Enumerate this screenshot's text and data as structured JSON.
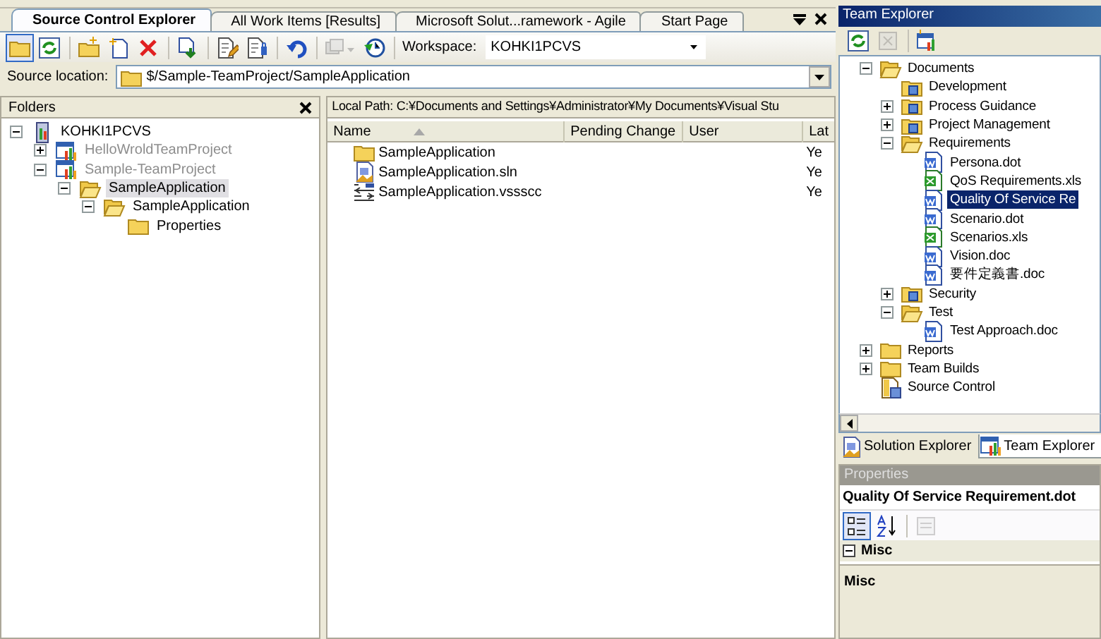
{
  "document_tabs": [
    {
      "label": "Source Control Explorer",
      "selected": true
    },
    {
      "label": "All Work Items [Results]",
      "selected": false
    },
    {
      "label": "Microsoft Solut...ramework - Agile",
      "selected": false
    },
    {
      "label": "Start Page",
      "selected": false
    }
  ],
  "toolbar": {
    "buttons": [
      {
        "kind": "folders",
        "pressed": true,
        "disabled": false
      },
      {
        "kind": "refresh",
        "pressed": false,
        "disabled": false
      },
      {
        "kind": "separator"
      },
      {
        "kind": "new-folder",
        "pressed": false,
        "disabled": false
      },
      {
        "kind": "add-files",
        "pressed": false,
        "disabled": false
      },
      {
        "kind": "delete",
        "pressed": false,
        "disabled": false
      },
      {
        "kind": "separator"
      },
      {
        "kind": "get-latest",
        "pressed": false,
        "disabled": false
      },
      {
        "kind": "separator"
      },
      {
        "kind": "check-out",
        "pressed": false,
        "disabled": false
      },
      {
        "kind": "check-in",
        "pressed": false,
        "disabled": false
      },
      {
        "kind": "separator"
      },
      {
        "kind": "undo",
        "pressed": false,
        "disabled": false
      },
      {
        "kind": "separator"
      },
      {
        "kind": "shelve",
        "pressed": false,
        "disabled": true
      },
      {
        "kind": "history",
        "pressed": false,
        "disabled": false
      }
    ],
    "workspace_label": "Workspace:",
    "workspace_value": "KOHKI1PCVS"
  },
  "source_location": {
    "label": "Source location:",
    "path": "$/Sample-TeamProject/SampleApplication"
  },
  "folders_pane": {
    "title": "Folders",
    "tree": [
      {
        "label": "KOHKI1PCVS",
        "kind": "server",
        "expanded": true,
        "selected": false,
        "dimmed": false,
        "children": [
          {
            "label": "HelloWroldTeamProject",
            "kind": "project",
            "expanded": false,
            "selected": false,
            "dimmed": true
          },
          {
            "label": "Sample-TeamProject",
            "kind": "project",
            "expanded": true,
            "selected": false,
            "dimmed": true,
            "children": [
              {
                "label": "SampleApplication",
                "kind": "folder-open",
                "expanded": true,
                "selected": true,
                "dimmed": false,
                "children": [
                  {
                    "label": "SampleApplication",
                    "kind": "folder-open",
                    "expanded": true,
                    "selected": false,
                    "dimmed": false,
                    "children": [
                      {
                        "label": "Properties",
                        "kind": "folder",
                        "selected": false,
                        "dimmed": false
                      }
                    ]
                  }
                ]
              }
            ]
          }
        ]
      }
    ]
  },
  "items_pane": {
    "local_path": "Local Path: C:¥Documents and Settings¥Administrator¥My Documents¥Visual Stu",
    "columns": [
      {
        "label": "Name",
        "sorted": true
      },
      {
        "label": "Pending Change",
        "sorted": false
      },
      {
        "label": "User",
        "sorted": false
      },
      {
        "label": "Lat",
        "sorted": false
      }
    ],
    "rows": [
      {
        "kind": "folder",
        "name": "SampleApplication",
        "column_4": "Ye"
      },
      {
        "kind": "solution",
        "name": "SampleApplication.sln",
        "column_4": "Ye"
      },
      {
        "kind": "binding",
        "name": "SampleApplication.vssscc",
        "column_4": "Ye"
      }
    ]
  },
  "team_explorer": {
    "title": "Team Explorer",
    "toolbar": [
      {
        "kind": "refresh",
        "disabled": false
      },
      {
        "kind": "stop",
        "disabled": true
      },
      {
        "kind": "separator"
      },
      {
        "kind": "add-project",
        "disabled": false
      }
    ],
    "tree": [
      {
        "label": "Documents",
        "kind": "folder-open",
        "expanded": true,
        "selected": false,
        "children": [
          {
            "label": "Development",
            "kind": "folder-doc",
            "selected": false
          },
          {
            "label": "Process Guidance",
            "kind": "folder-doc",
            "expanded": false,
            "selected": false
          },
          {
            "label": "Project Management",
            "kind": "folder-doc",
            "expanded": false,
            "selected": false
          },
          {
            "label": "Requirements",
            "kind": "folder-open",
            "expanded": true,
            "selected": false,
            "children": [
              {
                "label": "Persona.dot",
                "kind": "doc",
                "selected": false
              },
              {
                "label": "QoS Requirements.xls",
                "kind": "xls",
                "selected": false
              },
              {
                "label": "Quality Of Service Re",
                "kind": "doc",
                "selected": true
              },
              {
                "label": "Scenario.dot",
                "kind": "doc",
                "selected": false
              },
              {
                "label": "Scenarios.xls",
                "kind": "xls",
                "selected": false
              },
              {
                "label": "Vision.doc",
                "kind": "doc",
                "selected": false
              },
              {
                "label": "要件定義書.doc",
                "kind": "doc",
                "selected": false
              }
            ]
          },
          {
            "label": "Security",
            "kind": "folder-doc",
            "expanded": false,
            "selected": false
          },
          {
            "label": "Test",
            "kind": "folder-open",
            "expanded": true,
            "selected": false,
            "children": [
              {
                "label": "Test Approach.doc",
                "kind": "doc",
                "selected": false
              }
            ]
          }
        ]
      },
      {
        "label": "Reports",
        "kind": "folder",
        "expanded": false,
        "selected": false
      },
      {
        "label": "Team Builds",
        "kind": "folder",
        "expanded": false,
        "selected": false
      },
      {
        "label": "Source Control",
        "kind": "source-control",
        "selected": false
      }
    ]
  },
  "bottom_tabs": [
    {
      "label": "Solution Explorer",
      "kind": "solution",
      "selected": false
    },
    {
      "label": "Team Explorer",
      "kind": "project",
      "selected": true
    }
  ],
  "properties": {
    "title": "Properties",
    "object": "Quality Of Service Requirement.dot",
    "view_buttons": [
      {
        "kind": "categorized",
        "selected": true,
        "disabled": false
      },
      {
        "kind": "alphabetical",
        "selected": false,
        "disabled": false
      },
      {
        "kind": "separator"
      },
      {
        "kind": "property-pages",
        "selected": false,
        "disabled": true
      }
    ],
    "category": {
      "label": "Misc",
      "expanded": true
    },
    "description_title": "Misc"
  }
}
